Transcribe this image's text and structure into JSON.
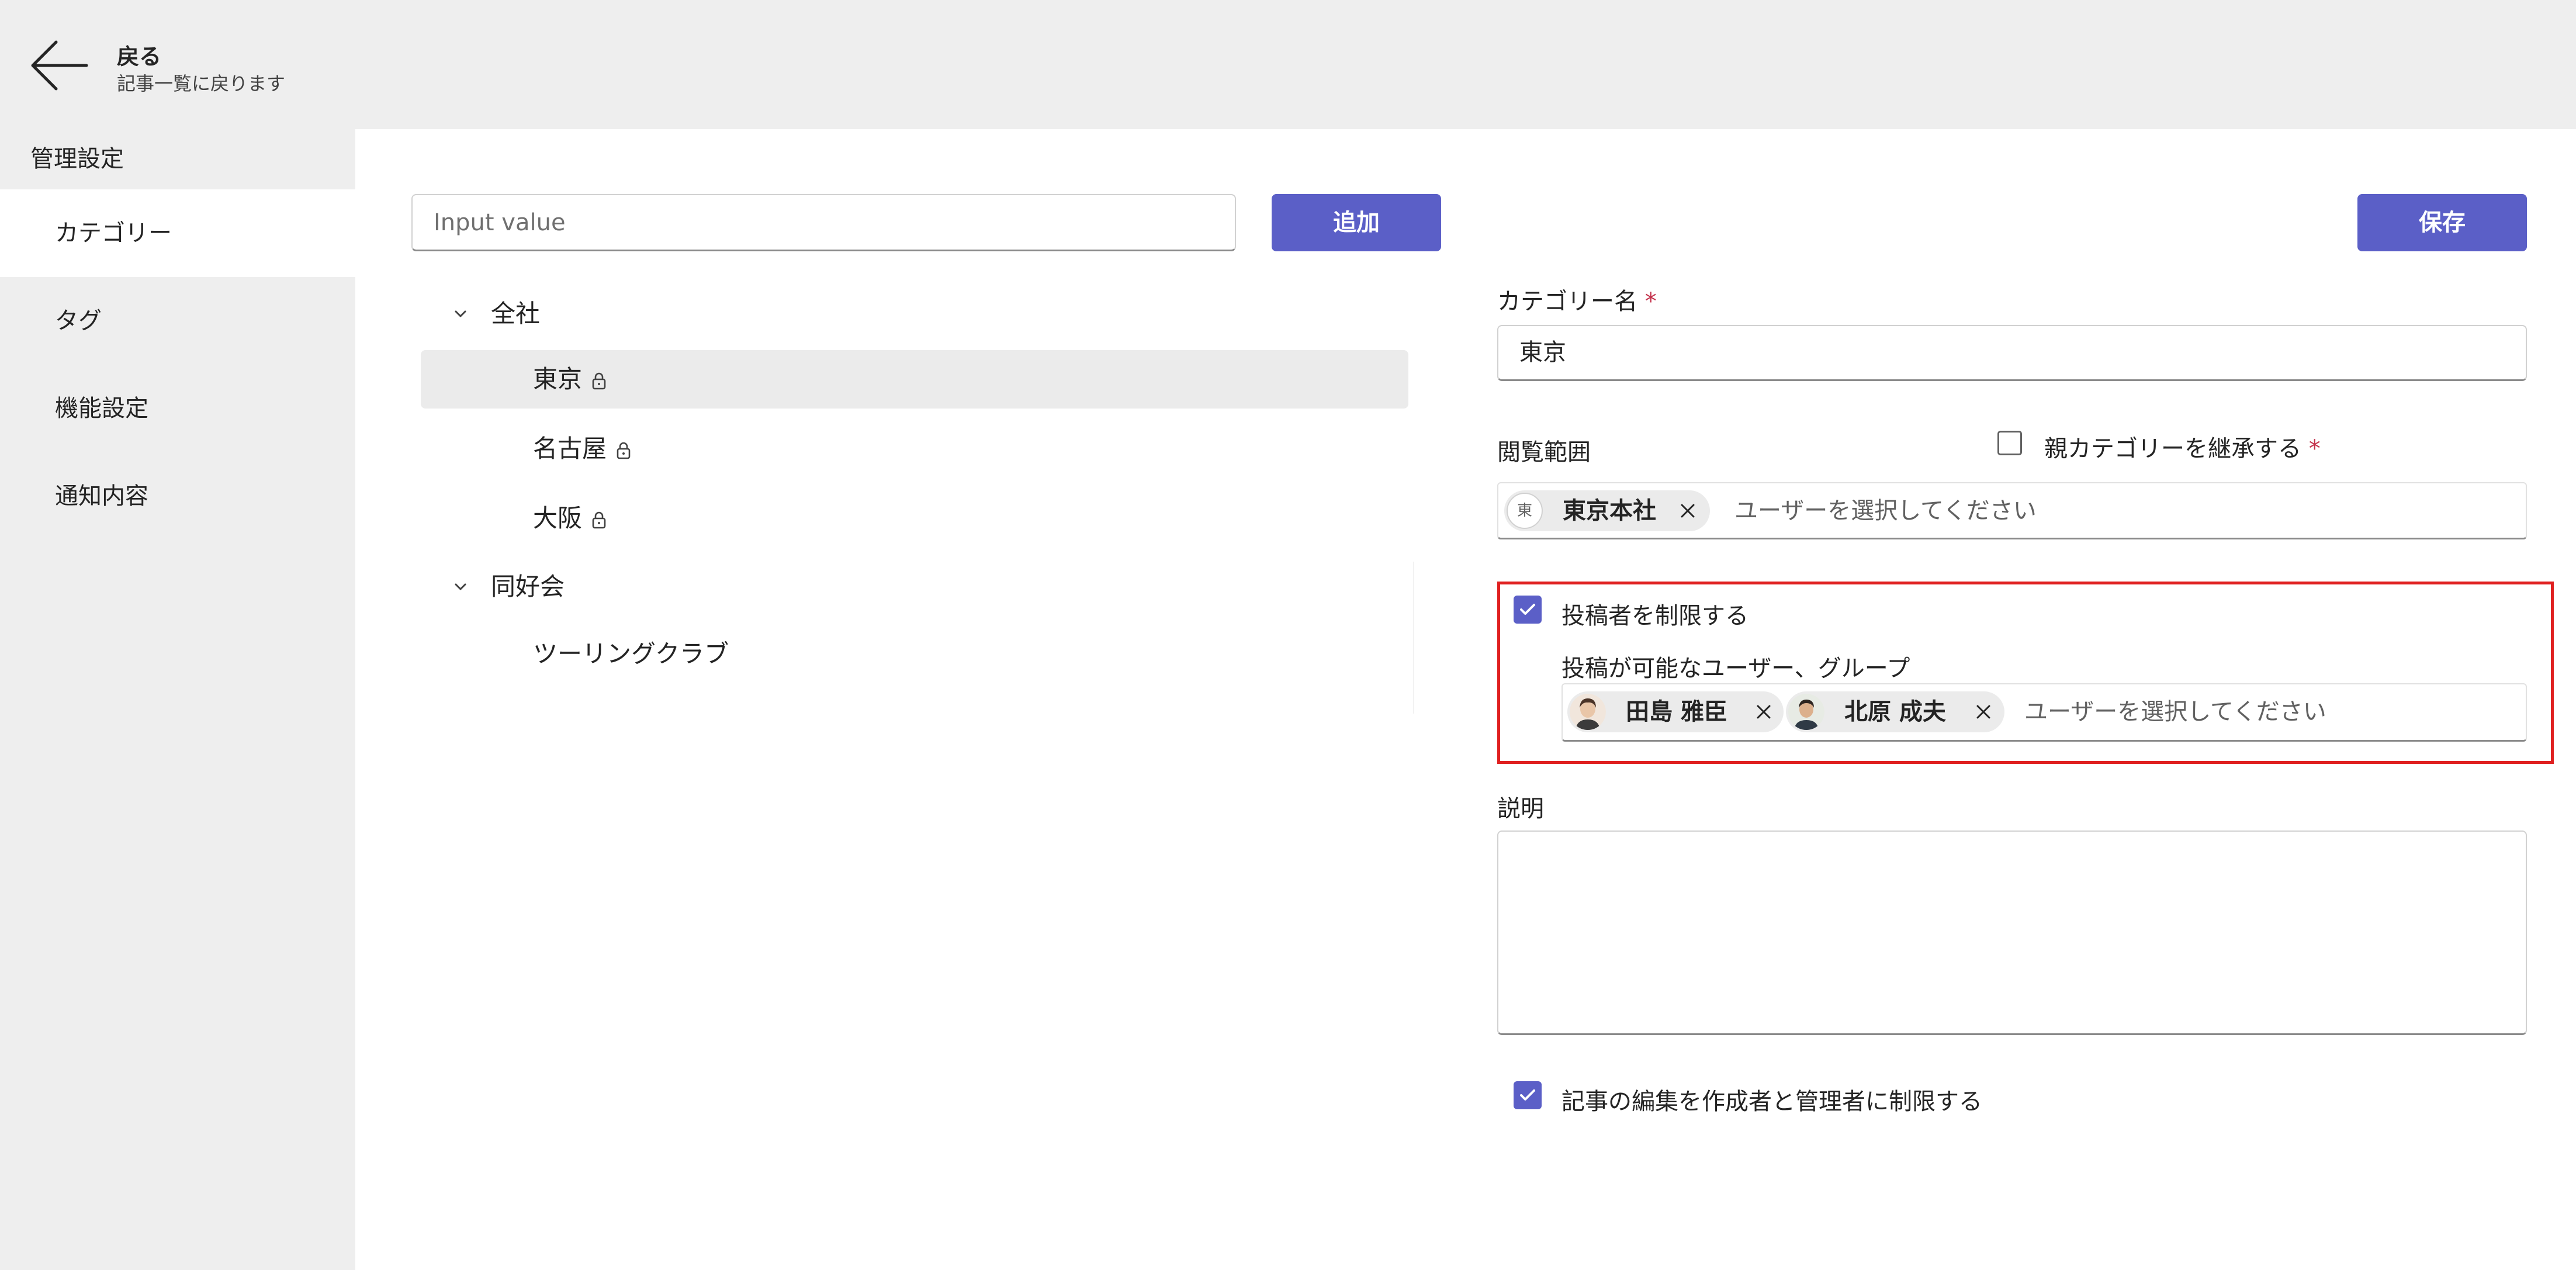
{
  "header": {
    "back_title": "戻る",
    "back_subtitle": "記事一覧に戻ります"
  },
  "sidebar": {
    "heading": "管理設定",
    "items": [
      {
        "label": "カテゴリー",
        "active": true
      },
      {
        "label": "タグ",
        "active": false
      },
      {
        "label": "機能設定",
        "active": false
      },
      {
        "label": "通知内容",
        "active": false
      }
    ]
  },
  "toolbar": {
    "new_category_placeholder": "Input value",
    "add_label": "追加",
    "save_label": "保存"
  },
  "tree": {
    "groups": [
      {
        "label": "全社",
        "expanded": true,
        "children": [
          {
            "label": "東京",
            "locked": true,
            "selected": true
          },
          {
            "label": "名古屋",
            "locked": true,
            "selected": false
          },
          {
            "label": "大阪",
            "locked": true,
            "selected": false
          }
        ]
      },
      {
        "label": "同好会",
        "expanded": true,
        "children": [
          {
            "label": "ツーリングクラブ",
            "locked": false,
            "selected": false
          }
        ]
      }
    ]
  },
  "form": {
    "category_name_label": "カテゴリー名",
    "required_mark": "*",
    "category_name_value": "東京",
    "view_scope_label": "閲覧範囲",
    "inherit_parent_label": "親カテゴリーを継承する",
    "inherit_parent_checked": false,
    "view_scope_chips": [
      {
        "avatar_text": "東",
        "label": "東京本社"
      }
    ],
    "user_picker_placeholder": "ユーザーを選択してください",
    "restrict_posters_label": "投稿者を制限する",
    "restrict_posters_checked": true,
    "allowed_posters_label": "投稿が可能なユーザー、グループ",
    "allowed_poster_chips": [
      {
        "label": "田島 雅臣"
      },
      {
        "label": "北原 成夫"
      }
    ],
    "description_label": "説明",
    "description_value": "",
    "restrict_edit_label": "記事の編集を作成者と管理者に制限する",
    "restrict_edit_checked": true
  },
  "colors": {
    "accent": "#5b5fc7",
    "highlight": "#e02020",
    "required": "#c4314b",
    "chrome": "#eeeeee"
  },
  "icons": {
    "back": "arrow-left-icon",
    "expand": "chevron-down-icon",
    "lock": "lock-icon",
    "remove": "dismiss-icon",
    "checkbox": "checkmark-icon"
  }
}
